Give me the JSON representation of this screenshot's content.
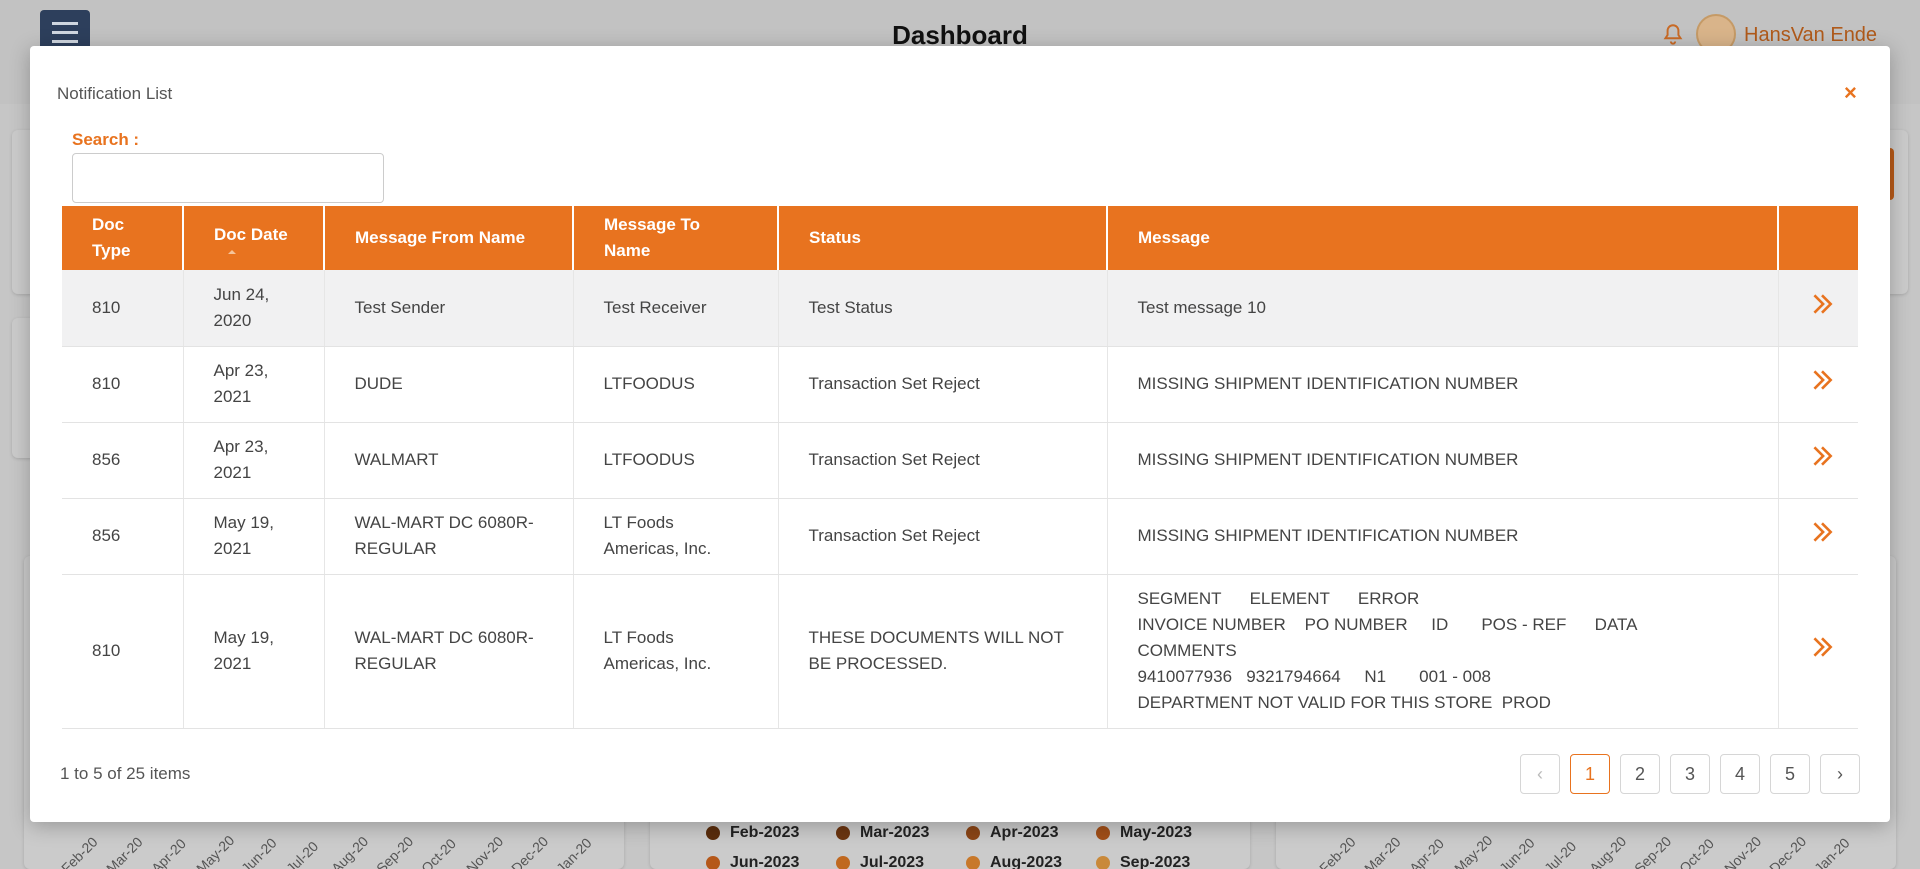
{
  "header": {
    "title": "Dashboard",
    "user_name": "HansVan Ende"
  },
  "modal": {
    "title": "Notification List",
    "close_glyph": "×",
    "search_label": "Search :",
    "search_value": "",
    "columns": [
      "Doc Type",
      "Doc Date",
      "Message From Name",
      "Message To Name",
      "Status",
      "Message",
      ""
    ],
    "rows": [
      {
        "doc_type": "810",
        "doc_date": "Jun 24, 2020",
        "from": "Test Sender",
        "to": "Test Receiver",
        "status": "Test Status",
        "message": [
          "Test message 10"
        ]
      },
      {
        "doc_type": "810",
        "doc_date": "Apr 23, 2021",
        "from": "DUDE",
        "to": "LTFOODUS",
        "status": "Transaction Set Reject",
        "message": [
          "MISSING SHIPMENT IDENTIFICATION NUMBER"
        ]
      },
      {
        "doc_type": "856",
        "doc_date": "Apr 23, 2021",
        "from": "WALMART",
        "to": "LTFOODUS",
        "status": "Transaction Set Reject",
        "message": [
          "MISSING SHIPMENT IDENTIFICATION NUMBER"
        ]
      },
      {
        "doc_type": "856",
        "doc_date": "May 19, 2021",
        "from": "WAL-MART DC 6080R-REGULAR",
        "to": "LT Foods Americas, Inc.",
        "status": "Transaction Set Reject",
        "message": [
          "MISSING SHIPMENT IDENTIFICATION NUMBER"
        ]
      },
      {
        "doc_type": "810",
        "doc_date": "May 19, 2021",
        "from": "WAL-MART DC 6080R-REGULAR",
        "to": "LT Foods Americas, Inc.",
        "status": "THESE DOCUMENTS WILL NOT BE PROCESSED.",
        "message": [
          "SEGMENT      ELEMENT      ERROR",
          "INVOICE NUMBER    PO NUMBER     ID       POS - REF      DATA",
          "COMMENTS",
          "9410077936   9321794664     N1       001 - 008",
          "DEPARTMENT NOT VALID FOR THIS STORE  PROD"
        ]
      }
    ],
    "pager": {
      "summary": "1 to 5 of 25 items",
      "prev_glyph": "‹",
      "next_glyph": "›",
      "pages": [
        "1",
        "2",
        "3",
        "4",
        "5"
      ],
      "active_page": "1"
    }
  },
  "background": {
    "axis_months_left": [
      "Feb-20",
      "Mar-20",
      "Apr-20",
      "May-20",
      "Jun-20",
      "Jul-20",
      "Aug-20",
      "Sep-20",
      "Oct-20",
      "Nov-20",
      "Dec-20",
      "Jan-20"
    ],
    "axis_months_right": [
      "Feb-20",
      "Mar-20",
      "Apr-20",
      "May-20",
      "Jun-20",
      "Jul-20",
      "Aug-20",
      "Sep-20",
      "Oct-20",
      "Nov-20",
      "Dec-20",
      "Jan-20"
    ],
    "legend": [
      {
        "label": "Feb-2023",
        "color": "#5a2d0c"
      },
      {
        "label": "Mar-2023",
        "color": "#6b3510"
      },
      {
        "label": "Apr-2023",
        "color": "#8a4516"
      },
      {
        "label": "May-2023",
        "color": "#a14f18"
      },
      {
        "label": "Jun-2023",
        "color": "#b5581a"
      },
      {
        "label": "Jul-2023",
        "color": "#c0681f"
      },
      {
        "label": "Aug-2023",
        "color": "#c8782a"
      },
      {
        "label": "Sep-2023",
        "color": "#c9893a"
      }
    ]
  },
  "colors": {
    "accent": "#e8731f",
    "overlay": "#b3b3b3"
  }
}
